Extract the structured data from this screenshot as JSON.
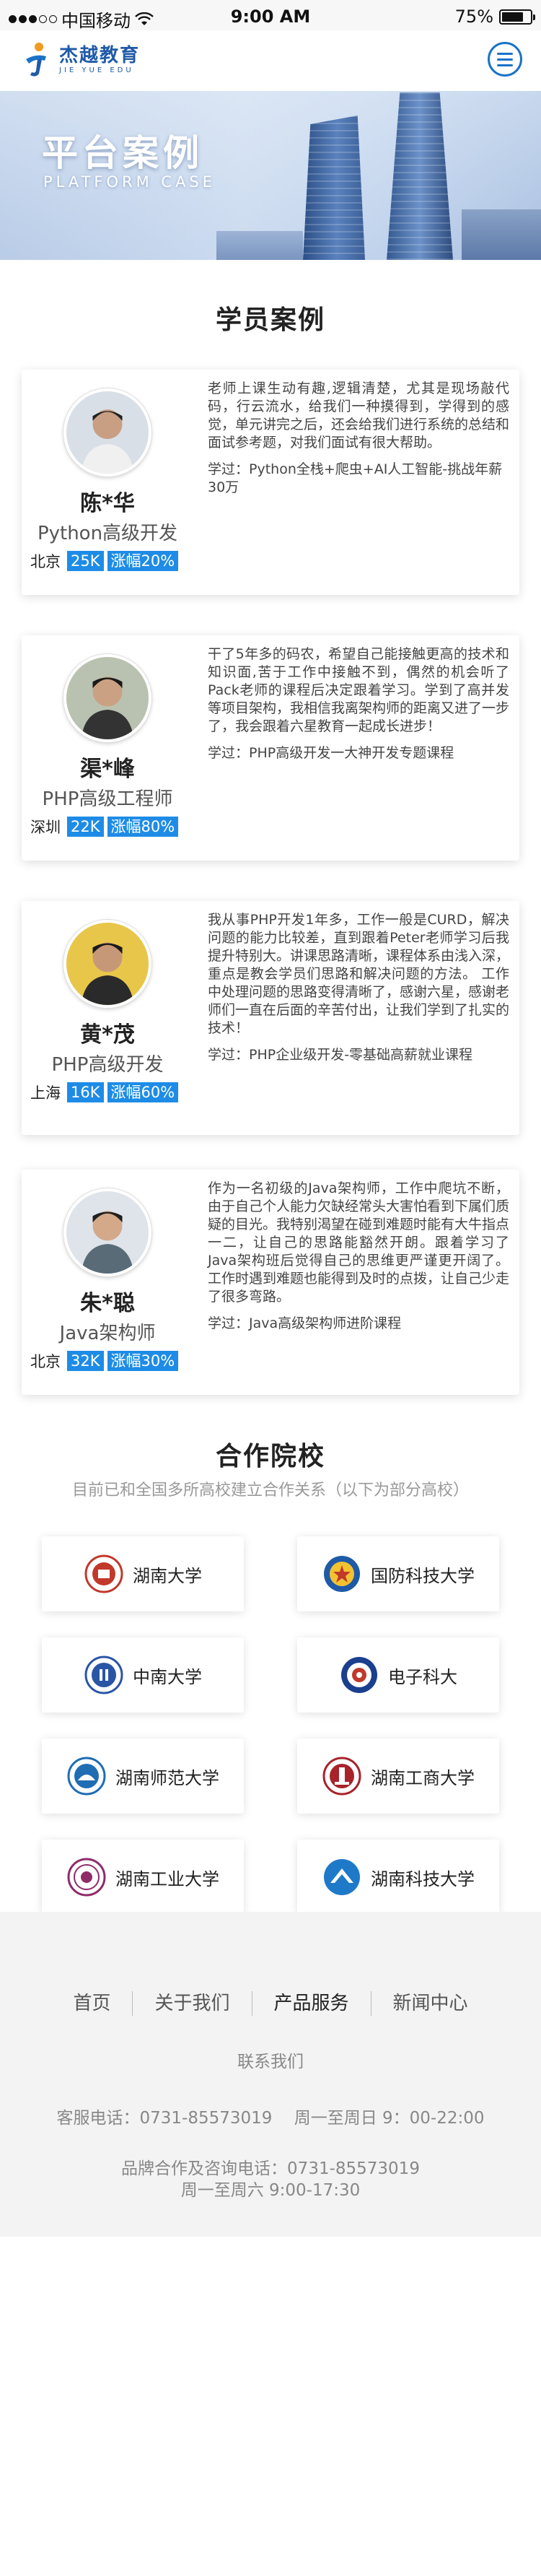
{
  "status_bar": {
    "carrier": "中国移动",
    "time": "9:00 AM",
    "battery": "75%",
    "battery_level": 0.75
  },
  "header": {
    "brand_name": "杰越教育",
    "brand_sub": "JIE YUE EDU"
  },
  "banner": {
    "title": "平台案例",
    "subtitle": "PLATFORM CASE"
  },
  "cases": {
    "title": "学员案例",
    "items": [
      {
        "name": "陈*华",
        "role": "Python高级开发",
        "city": "北京",
        "salary": "25K",
        "raise": "涨幅20%",
        "story": "老师上课生动有趣,逻辑清楚，尤其是现场敲代码，行云流水，给我们一种摸得到，学得到的感觉，单元讲完之后，还会给我们进行系统的总结和面试参考题，对我们面试有很大帮助。",
        "course": "学过：Python全栈+爬虫+AI人工智能-挑战年薪30万"
      },
      {
        "name": "渠*峰",
        "role": "PHP高级工程师",
        "city": "深圳",
        "salary": "22K",
        "raise": "涨幅80%",
        "story": "干了5年多的码农，希望自己能接触更高的技术和知识面,苦于工作中接触不到，偶然的机会听了Pack老师的课程后决定跟着学习。学到了高并发等项目架构，我相信我离架构师的距离又进了一步了，我会跟着六星教育一起成长进步！",
        "course": "学过：PHP高级开发一大神开发专题课程"
      },
      {
        "name": "黄*茂",
        "role": "PHP高级开发",
        "city": "上海",
        "salary": "16K",
        "raise": "涨幅60%",
        "story": "我从事PHP开发1年多，工作一般是CURD，解决问题的能力比较差，直到跟着Peter老师学习后我提升特别大。讲课思路清晰，课程体系由浅入深，重点是教会学员们思路和解决问题的方法。 工作中处理问题的思路变得清晰了，感谢六星，感谢老师们一直在后面的辛苦付出，让我们学到了扎实的技术！",
        "course": "学过：PHP企业级开发-零基础高薪就业课程"
      },
      {
        "name": "朱*聪",
        "role": "Java架构师",
        "city": "北京",
        "salary": "32K",
        "raise": "涨幅30%",
        "story": "作为一名初级的Java架构师，工作中爬坑不断，由于自己个人能力欠缺经常头大害怕看到下属们质疑的目光。我特别渴望在碰到难题时能有大牛指点一二，让自己的思路能豁然开朗。跟着学习了Java架构班后觉得自己的思维更严谨更开阔了。工作时遇到难题也能得到及时的点拨，让自己少走了很多弯路。",
        "course": "学过：Java高级架构师进阶课程"
      }
    ]
  },
  "partners": {
    "title": "合作院校",
    "subtitle": "目前已和全国多所高校建立合作关系（以下为部分高校）",
    "schools": [
      {
        "name": "湖南大学",
        "icon": "hunan-university-emblem",
        "color": "#c0392b"
      },
      {
        "name": "国防科技大学",
        "icon": "nudt-emblem",
        "color": "#1f5aa8"
      },
      {
        "name": "中南大学",
        "icon": "csu-emblem",
        "color": "#2a55a5"
      },
      {
        "name": "电子科大",
        "icon": "uestc-emblem",
        "color": "#1b3f8f"
      },
      {
        "name": "湖南师范大学",
        "icon": "hunnu-emblem",
        "color": "#1f6db3"
      },
      {
        "name": "湖南工商大学",
        "icon": "hutb-emblem",
        "color": "#a8232a"
      },
      {
        "name": "湖南工业大学",
        "icon": "hut-emblem",
        "color": "#8e2c6a"
      },
      {
        "name": "湖南科技大学",
        "icon": "hnust-emblem",
        "color": "#1f79c9"
      }
    ]
  },
  "footer": {
    "nav": [
      "首页",
      "关于我们",
      "产品服务",
      "新闻中心"
    ],
    "contact_label": "联系我们",
    "service_phone": "客服电话：0731-85573019　 周一至周日 9：00-22:00",
    "brand_phone": "品牌合作及咨询电话：0731-85573019",
    "brand_hours": "周一至周六 9:00-17:30"
  }
}
